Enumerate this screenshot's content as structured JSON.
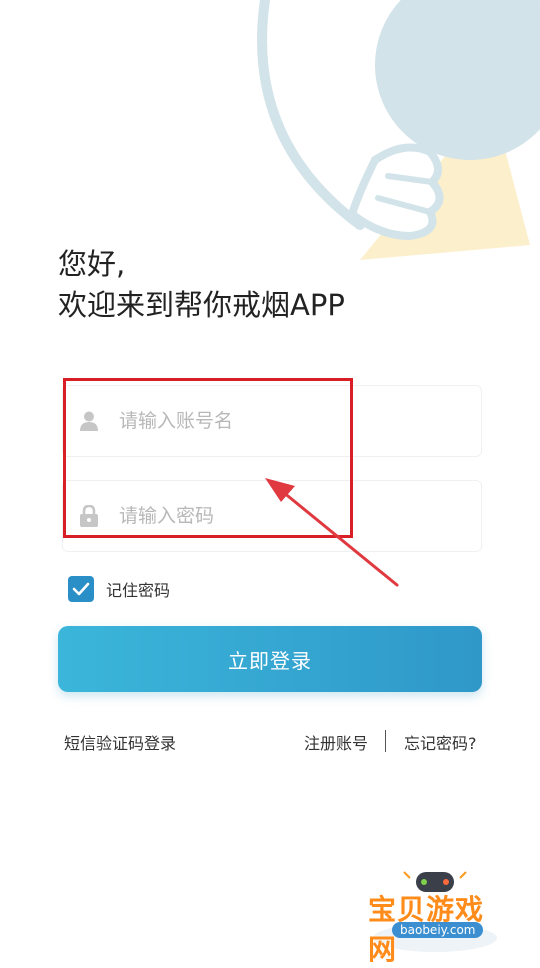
{
  "greeting": {
    "line1": "您好,",
    "line2": "欢迎来到帮你戒烟APP"
  },
  "form": {
    "account": {
      "placeholder": "请输入账号名",
      "value": "",
      "icon": "person-icon"
    },
    "password": {
      "placeholder": "请输入密码",
      "value": "",
      "icon": "lock-icon"
    },
    "remember": {
      "label": "记住密码",
      "checked": true
    }
  },
  "login_button": "立即登录",
  "links": {
    "sms_login": "短信验证码登录",
    "register": "注册账号",
    "forgot": "忘记密码?"
  },
  "watermark": {
    "title": "宝贝游戏网",
    "url": "baobeiy.com"
  },
  "colors": {
    "accent": "#2f98c9",
    "annotation": "#d81f26",
    "deco_blue": "#d3e3ea",
    "deco_yellow": "#fcefcc"
  }
}
